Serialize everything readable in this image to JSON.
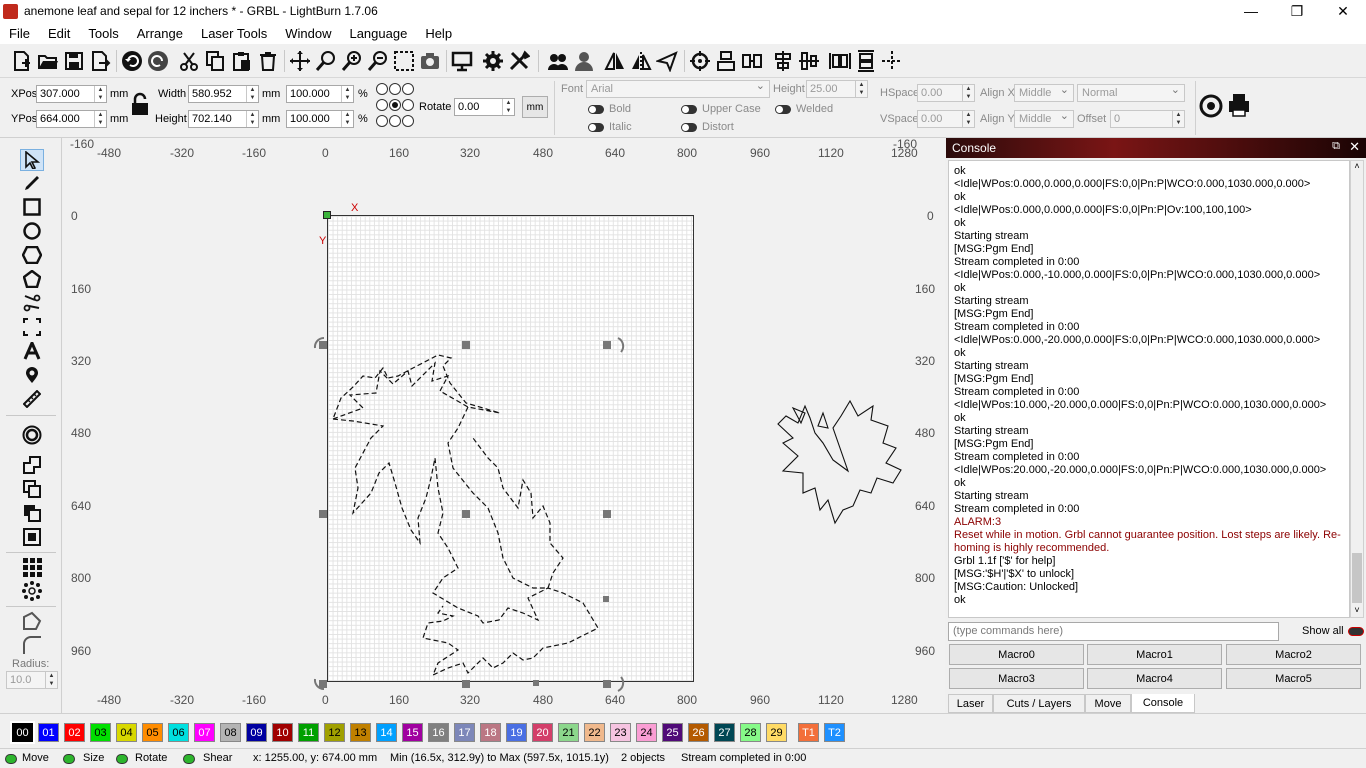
{
  "window": {
    "title": "anemone leaf and sepal for 12 inchers * - GRBL - LightBurn 1.7.06",
    "minimize": "—",
    "maximize": "❐",
    "close": "✕"
  },
  "menu": [
    "File",
    "Edit",
    "Tools",
    "Arrange",
    "Laser Tools",
    "Window",
    "Language",
    "Help"
  ],
  "props": {
    "xpos_label": "XPos",
    "xpos": "307.000",
    "ypos_label": "YPos",
    "ypos": "664.000",
    "unit": "mm",
    "width_label": "Width",
    "width": "580.952",
    "height_label": "Height",
    "height": "702.140",
    "scale_w": "100.000",
    "scale_h": "100.000",
    "pct": "%",
    "rotate_label": "Rotate",
    "rotate": "0.00",
    "mm_button": "mm",
    "font_label": "Font",
    "font_value": "Arial",
    "fheight_label": "Height",
    "fheight": "25.00",
    "hspace_label": "HSpace",
    "hspace": "0.00",
    "vspace_label": "VSpace",
    "vspace": "0.00",
    "alignx_label": "Align X",
    "alignx": "Middle",
    "aligny_label": "Align Y",
    "aligny": "Middle",
    "normal": "Normal",
    "offset_label": "Offset",
    "offset": "0",
    "bold": "Bold",
    "italic": "Italic",
    "upper": "Upper Case",
    "distort": "Distort",
    "welded": "Welded"
  },
  "ruler": {
    "top": [
      "-480",
      "-320",
      "-160",
      "0",
      "160",
      "320",
      "480",
      "640",
      "800",
      "960",
      "1120",
      "1280"
    ],
    "bottom": [
      "-480",
      "-320",
      "-160",
      "0",
      "160",
      "320",
      "480",
      "640",
      "800",
      "960",
      "1120",
      "1280"
    ],
    "left": [
      "0",
      "160",
      "320",
      "480",
      "640",
      "800",
      "960"
    ],
    "right": [
      "0",
      "160",
      "320",
      "480",
      "640",
      "800",
      "960"
    ],
    "corner_top_left": "-160",
    "corner_top_right": "-160",
    "axis_x": "X",
    "axis_y": "Y"
  },
  "console": {
    "title": "Console",
    "lines": [
      "ok",
      "<Idle|WPos:0.000,0.000,0.000|FS:0,0|Pn:P|WCO:0.000,1030.000,0.000>",
      "ok",
      "<Idle|WPos:0.000,0.000,0.000|FS:0,0|Pn:P|Ov:100,100,100>",
      "ok",
      "Starting stream",
      "[MSG:Pgm End]",
      "Stream completed in 0:00",
      "<Idle|WPos:0.000,-10.000,0.000|FS:0,0|Pn:P|WCO:0.000,1030.000,0.000>",
      "ok",
      "Starting stream",
      "[MSG:Pgm End]",
      "Stream completed in 0:00",
      "<Idle|WPos:0.000,-20.000,0.000|FS:0,0|Pn:P|WCO:0.000,1030.000,0.000>",
      "ok",
      "Starting stream",
      "[MSG:Pgm End]",
      "Stream completed in 0:00",
      "<Idle|WPos:10.000,-20.000,0.000|FS:0,0|Pn:P|WCO:0.000,1030.000,0.000>",
      "ok",
      "Starting stream",
      "[MSG:Pgm End]",
      "Stream completed in 0:00",
      "<Idle|WPos:20.000,-20.000,0.000|FS:0,0|Pn:P|WCO:0.000,1030.000,0.000>",
      "ok",
      "Starting stream",
      "Stream completed in 0:00"
    ],
    "alarm": "ALARM:3",
    "alarm_msg": "Reset while in motion. Grbl cannot guarantee position. Lost steps are likely. Re-homing is highly recommended.",
    "tail": [
      "Grbl 1.1f ['$' for help]",
      "[MSG:'$H'|'$X' to unlock]",
      "[MSG:Caution: Unlocked]",
      "ok"
    ],
    "placeholder": "(type commands here)",
    "show_all": "Show all",
    "macros": [
      "Macro0",
      "Macro1",
      "Macro2",
      "Macro3",
      "Macro4",
      "Macro5"
    ],
    "tabs": [
      "Laser",
      "Cuts / Layers",
      "Move",
      "Console"
    ]
  },
  "left": {
    "radius_label": "Radius:",
    "radius": "10.0"
  },
  "palette": [
    {
      "l": "00",
      "c": "#000000",
      "t": "#ffffff"
    },
    {
      "l": "01",
      "c": "#0000ff",
      "t": "#ffffff"
    },
    {
      "l": "02",
      "c": "#ff0000",
      "t": "#ffffff"
    },
    {
      "l": "03",
      "c": "#00e000",
      "t": "#000000"
    },
    {
      "l": "04",
      "c": "#d8d800",
      "t": "#000000"
    },
    {
      "l": "05",
      "c": "#ff8c00",
      "t": "#000000"
    },
    {
      "l": "06",
      "c": "#00e0e0",
      "t": "#000000"
    },
    {
      "l": "07",
      "c": "#ff00ff",
      "t": "#ffffff"
    },
    {
      "l": "08",
      "c": "#b4b4b4",
      "t": "#000000"
    },
    {
      "l": "09",
      "c": "#0000a0",
      "t": "#ffffff"
    },
    {
      "l": "10",
      "c": "#a00000",
      "t": "#ffffff"
    },
    {
      "l": "11",
      "c": "#00a000",
      "t": "#ffffff"
    },
    {
      "l": "12",
      "c": "#a0a000",
      "t": "#000000"
    },
    {
      "l": "13",
      "c": "#c08000",
      "t": "#000000"
    },
    {
      "l": "14",
      "c": "#00a0ff",
      "t": "#ffffff"
    },
    {
      "l": "15",
      "c": "#a000a0",
      "t": "#ffffff"
    },
    {
      "l": "16",
      "c": "#808080",
      "t": "#ffffff"
    },
    {
      "l": "17",
      "c": "#7d87b9",
      "t": "#ffffff"
    },
    {
      "l": "18",
      "c": "#bb7784",
      "t": "#ffffff"
    },
    {
      "l": "19",
      "c": "#4a6fe3",
      "t": "#ffffff"
    },
    {
      "l": "20",
      "c": "#d33f6a",
      "t": "#ffffff"
    },
    {
      "l": "21",
      "c": "#8cd78c",
      "t": "#000000"
    },
    {
      "l": "22",
      "c": "#f0b98d",
      "t": "#000000"
    },
    {
      "l": "23",
      "c": "#f6c4e1",
      "t": "#000000"
    },
    {
      "l": "24",
      "c": "#fa9ed4",
      "t": "#000000"
    },
    {
      "l": "25",
      "c": "#500a78",
      "t": "#ffffff"
    },
    {
      "l": "26",
      "c": "#b45a00",
      "t": "#ffffff"
    },
    {
      "l": "27",
      "c": "#004754",
      "t": "#ffffff"
    },
    {
      "l": "28",
      "c": "#86fa88",
      "t": "#000000"
    },
    {
      "l": "29",
      "c": "#ffdb66",
      "t": "#000000"
    },
    {
      "l": "T1",
      "c": "#f36f3a",
      "t": "#ffffff"
    },
    {
      "l": "T2",
      "c": "#1e90ff",
      "t": "#ffffff"
    }
  ],
  "status": {
    "move": "Move",
    "size": "Size",
    "rotate": "Rotate",
    "shear": "Shear",
    "coords": "x: 1255.00, y: 674.00 mm",
    "bounds": "Min (16.5x, 312.9y) to Max (597.5x, 1015.1y)",
    "objects": "2 objects",
    "stream": "Stream completed in 0:00"
  }
}
